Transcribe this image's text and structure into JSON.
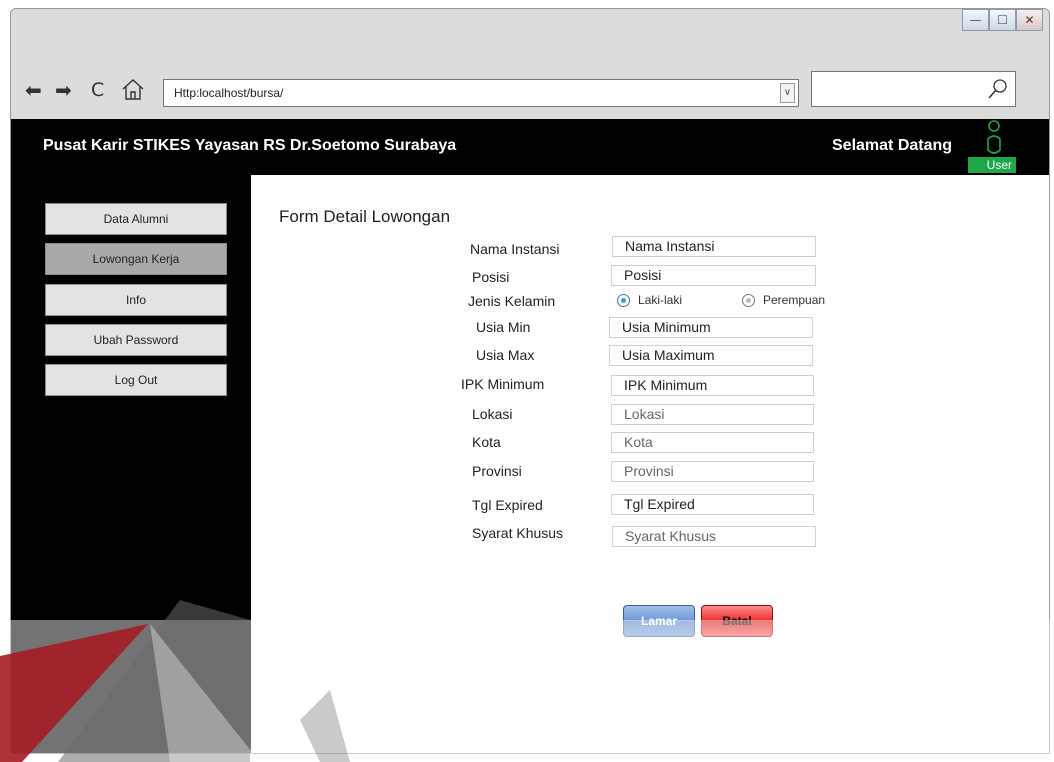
{
  "browser": {
    "url": "Http:localhost/bursa/",
    "window_controls": {
      "minimize": "—",
      "maximize": "☐",
      "close": "✕"
    }
  },
  "header": {
    "title": "Pusat Karir STIKES Yayasan RS Dr.Soetomo Surabaya",
    "welcome": "Selamat Datang",
    "user_label": "User"
  },
  "sidebar": {
    "items": [
      {
        "label": "Data Alumni"
      },
      {
        "label": "Lowongan Kerja"
      },
      {
        "label": "Info"
      },
      {
        "label": "Ubah Password"
      },
      {
        "label": "Log Out"
      }
    ]
  },
  "form": {
    "title": "Form Detail Lowongan",
    "fields": {
      "nama_instansi": {
        "label": "Nama Instansi",
        "value": "Nama Instansi"
      },
      "posisi": {
        "label": "Posisi",
        "value": "Posisi"
      },
      "jenis_kelamin": {
        "label": "Jenis Kelamin",
        "option_1": "Laki-laki",
        "option_2": "Perempuan"
      },
      "usia_min": {
        "label": "Usia Min",
        "value": "Usia Minimum"
      },
      "usia_max": {
        "label": "Usia Max",
        "value": "Usia Maximum"
      },
      "ipk_minimum": {
        "label": "IPK Minimum",
        "value": "IPK Minimum"
      },
      "lokasi": {
        "label": "Lokasi",
        "value": "Lokasi"
      },
      "kota": {
        "label": "Kota",
        "value": "Kota"
      },
      "provinsi": {
        "label": "Provinsi",
        "value": "Provinsi"
      },
      "tgl_expired": {
        "label": "Tgl Expired",
        "value": "Tgl Expired"
      },
      "syarat_khusus": {
        "label": "Syarat Khusus",
        "value": "Syarat Khusus"
      }
    },
    "buttons": {
      "lamar": "Lamar",
      "batal": "Batal"
    }
  },
  "colors": {
    "user_badge": "#1fa84a",
    "accent_red": "#b01e24",
    "lamar": "#6f97d6",
    "batal": "#ee2b2b"
  },
  "icons": [
    "back-arrow-icon",
    "forward-arrow-icon",
    "refresh-icon",
    "home-icon",
    "search-icon",
    "user-icon"
  ]
}
